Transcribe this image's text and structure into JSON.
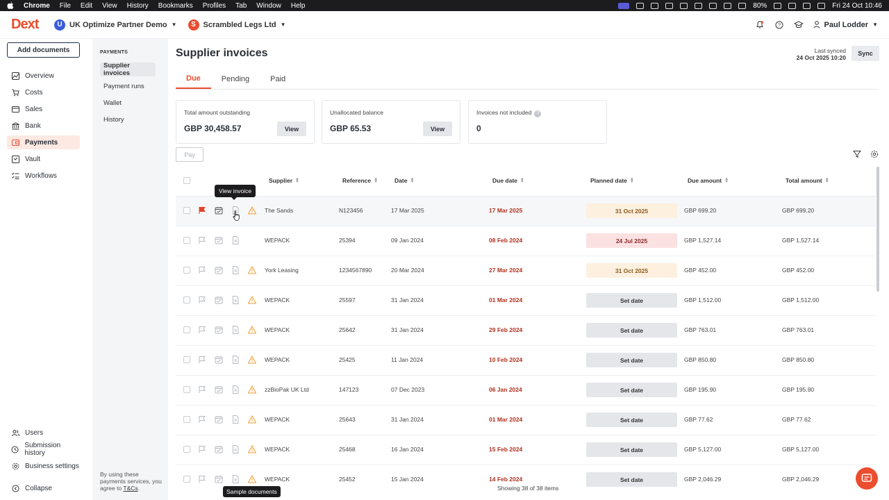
{
  "macos": {
    "app": "Chrome",
    "menus": [
      "File",
      "Edit",
      "View",
      "History",
      "Bookmarks",
      "Profiles",
      "Tab",
      "Window",
      "Help"
    ],
    "battery": "80%",
    "clock": "Fri 24 Oct  10:46"
  },
  "header": {
    "logo": "Dext",
    "org1": {
      "initial": "U",
      "name": "UK Optimize Partner Demo",
      "color": "#3a5bd9"
    },
    "org2": {
      "initial": "S",
      "name": "Scrambled Legs Ltd",
      "color": "#ea4e2e"
    },
    "user": "Paul Lodder"
  },
  "nav": {
    "add_documents": "Add documents",
    "items": [
      "Overview",
      "Costs",
      "Sales",
      "Bank",
      "Payments",
      "Vault",
      "Workflows"
    ],
    "bottom": [
      "Users",
      "Submission history",
      "Business settings",
      "Collapse"
    ]
  },
  "subnav": {
    "heading": "PAYMENTS",
    "items": [
      "Supplier invoices",
      "Payment runs",
      "Wallet",
      "History"
    ],
    "terms_prefix": "By using these payments services, you agree to ",
    "terms_link": "T&Cs",
    "terms_suffix": "."
  },
  "main": {
    "title": "Supplier invoices",
    "last_synced_label": "Last synced",
    "last_synced_value": "24 Oct 2025 10:20",
    "sync_label": "Sync",
    "tabs": [
      "Due",
      "Pending",
      "Paid"
    ],
    "cards": [
      {
        "label": "Total amount outstanding",
        "value": "GBP 30,458.57",
        "button": "View"
      },
      {
        "label": "Unallocated balance",
        "value": "GBP 65.53",
        "button": "View"
      },
      {
        "label": "Invoices not included",
        "value": "0",
        "help": "?"
      }
    ],
    "pay_label": "Pay"
  },
  "table": {
    "columns": [
      "Supplier",
      "Reference",
      "Date",
      "Due date",
      "Planned date",
      "Due amount",
      "Total amount"
    ],
    "rows": [
      {
        "supplier": "The Sands",
        "reference": "N123456",
        "date": "17 Mar 2025",
        "due": "17 Mar 2025",
        "planned": "31 Oct 2025",
        "planned_style": "yellow",
        "due_amount": "GBP 699.20",
        "total": "GBP 699.20",
        "flagged": true,
        "warn": true
      },
      {
        "supplier": "WEPACK",
        "reference": "25394",
        "date": "09 Jan 2024",
        "due": "08 Feb 2024",
        "planned": "24 Jul 2025",
        "planned_style": "red",
        "due_amount": "GBP 1,527.14",
        "total": "GBP 1,527.14",
        "flagged": false,
        "warn": false
      },
      {
        "supplier": "York Leasing",
        "reference": "1234567890",
        "date": "20 Mar 2024",
        "due": "27 Mar 2024",
        "planned": "31 Oct 2025",
        "planned_style": "yellow",
        "due_amount": "GBP 452.00",
        "total": "GBP 452.00",
        "flagged": false,
        "warn": true
      },
      {
        "supplier": "WEPACK",
        "reference": "25597",
        "date": "31 Jan 2024",
        "due": "01 Mar 2024",
        "planned": "Set date",
        "planned_style": "grey",
        "due_amount": "GBP 1,512.00",
        "total": "GBP 1,512.00",
        "flagged": false,
        "warn": true
      },
      {
        "supplier": "WEPACK",
        "reference": "25642",
        "date": "31 Jan 2024",
        "due": "29 Feb 2024",
        "planned": "Set date",
        "planned_style": "grey",
        "due_amount": "GBP 763.01",
        "total": "GBP 763.01",
        "flagged": false,
        "warn": true
      },
      {
        "supplier": "WEPACK",
        "reference": "25425",
        "date": "11 Jan 2024",
        "due": "10 Feb 2024",
        "planned": "Set date",
        "planned_style": "grey",
        "due_amount": "GBP 850.80",
        "total": "GBP 850.80",
        "flagged": false,
        "warn": true
      },
      {
        "supplier": "zzBioPak UK Ltd",
        "reference": "147123",
        "date": "07 Dec 2023",
        "due": "06 Jan 2024",
        "planned": "Set date",
        "planned_style": "grey",
        "due_amount": "GBP 195.90",
        "total": "GBP 195.90",
        "flagged": false,
        "warn": true
      },
      {
        "supplier": "WEPACK",
        "reference": "25643",
        "date": "31 Jan 2024",
        "due": "01 Mar 2024",
        "planned": "Set date",
        "planned_style": "grey",
        "due_amount": "GBP 77.62",
        "total": "GBP 77.62",
        "flagged": false,
        "warn": true
      },
      {
        "supplier": "WEPACK",
        "reference": "25468",
        "date": "16 Jan 2024",
        "due": "15 Feb 2024",
        "planned": "Set date",
        "planned_style": "grey",
        "due_amount": "GBP 5,127.00",
        "total": "GBP 5,127.00",
        "flagged": false,
        "warn": true
      },
      {
        "supplier": "WEPACK",
        "reference": "25452",
        "date": "15 Jan 2024",
        "due": "14 Feb 2024",
        "planned": "Set date",
        "planned_style": "grey",
        "due_amount": "GBP 2,046.29",
        "total": "GBP 2,046.29",
        "flagged": false,
        "warn": true
      }
    ],
    "footer": "Showing 38 of 38 items"
  },
  "tooltip": "View invoice",
  "sample_documents": "Sample documents"
}
